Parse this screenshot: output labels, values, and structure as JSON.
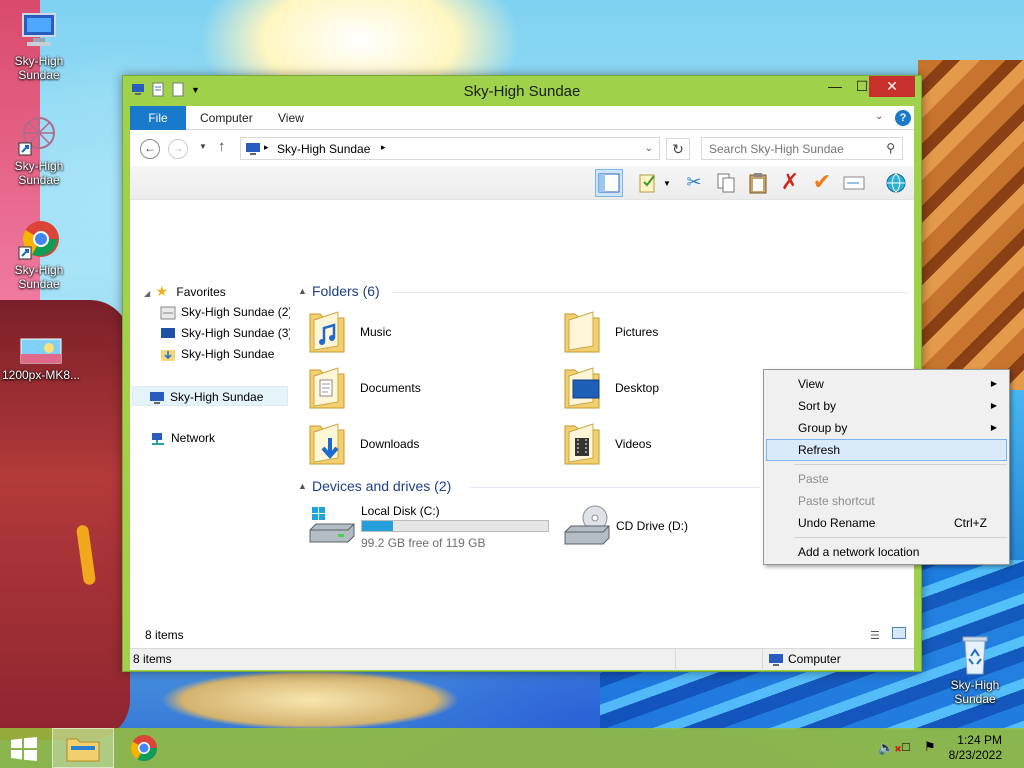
{
  "desktop": {
    "icons": [
      {
        "label": "Sky-High Sundae",
        "icon": "computer-icon"
      },
      {
        "label": "Sky-High Sundae",
        "icon": "network-shortcut-icon"
      },
      {
        "label": "Sky-High Sundae",
        "icon": "chrome-shortcut-icon"
      },
      {
        "label": "1200px-MK8...",
        "icon": "image-file-icon"
      },
      {
        "label": "Sky-High Sundae",
        "icon": "recycle-bin-icon"
      }
    ]
  },
  "window": {
    "title": "Sky-High Sundae",
    "ribbon_tabs": [
      "File",
      "Computer",
      "View"
    ],
    "address": "Sky-High Sundae",
    "search_placeholder": "Search Sky-High Sundae",
    "nav": {
      "favorites_label": "Favorites",
      "favorites": [
        "Sky-High Sundae (2)",
        "Sky-High Sundae (3)",
        "Sky-High Sundae"
      ],
      "computer_label": "Sky-High Sundae",
      "network_label": "Network"
    },
    "folders_header": "Folders (6)",
    "folders": [
      "Music",
      "Pictures",
      "Documents",
      "Desktop",
      "Downloads",
      "Videos"
    ],
    "devices_header": "Devices and drives (2)",
    "drives": {
      "c_name": "Local Disk (C:)",
      "c_free": "99.2 GB free of 119 GB",
      "c_used_fraction": 0.167,
      "d_name": "CD Drive (D:)"
    },
    "status_items": "8 items",
    "status_items_bottom": "8 items",
    "status_location": "Computer"
  },
  "context_menu": {
    "view": "View",
    "sort_by": "Sort by",
    "group_by": "Group by",
    "refresh": "Refresh",
    "paste": "Paste",
    "paste_shortcut": "Paste shortcut",
    "undo_rename": "Undo Rename",
    "undo_shortcut": "Ctrl+Z",
    "add_network": "Add a network location"
  },
  "taskbar": {
    "time": "1:24 PM",
    "date": "8/23/2022"
  },
  "colors": {
    "window_frame": "#9fd24a",
    "file_tab": "#1979ca",
    "close_button": "#c7302b",
    "menu_highlight": "#dbeaf9",
    "drive_bar": "#26a0da"
  }
}
